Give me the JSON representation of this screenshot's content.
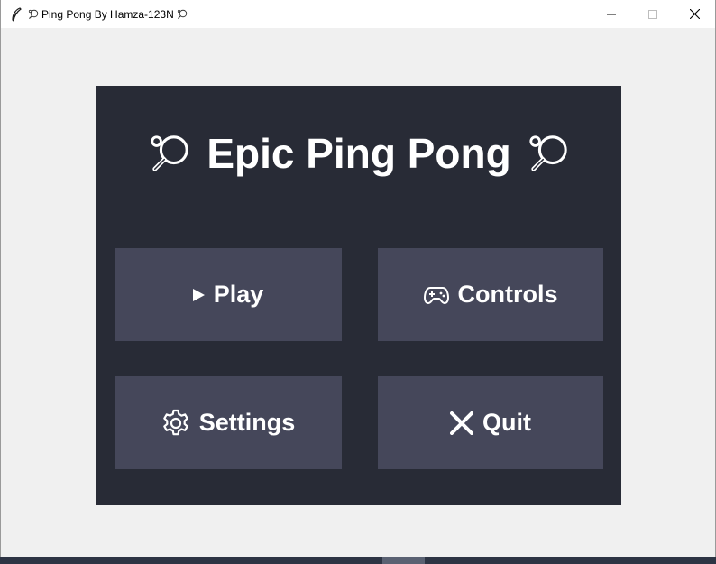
{
  "window": {
    "title": "Ping Pong By Hamza-123N",
    "title_icon_left": "ping-pong-paddle-icon",
    "title_icon_right": "ping-pong-paddle-icon",
    "app_icon": "feather-icon",
    "controls": {
      "minimize": "minimize-icon",
      "maximize": "maximize-icon",
      "close": "close-icon"
    }
  },
  "menu": {
    "heading": "Epic Ping Pong",
    "heading_icon": "ping-pong-paddle-icon",
    "buttons": [
      {
        "label": "Play",
        "icon": "play-triangle-icon"
      },
      {
        "label": "Controls",
        "icon": "gamepad-icon"
      },
      {
        "label": "Settings",
        "icon": "gear-icon"
      },
      {
        "label": "Quit",
        "icon": "x-mark-icon"
      }
    ]
  },
  "colors": {
    "window_bg": "#f0f0f0",
    "panel_bg": "#282b36",
    "button_bg": "#45475a",
    "text": "#ffffff"
  }
}
